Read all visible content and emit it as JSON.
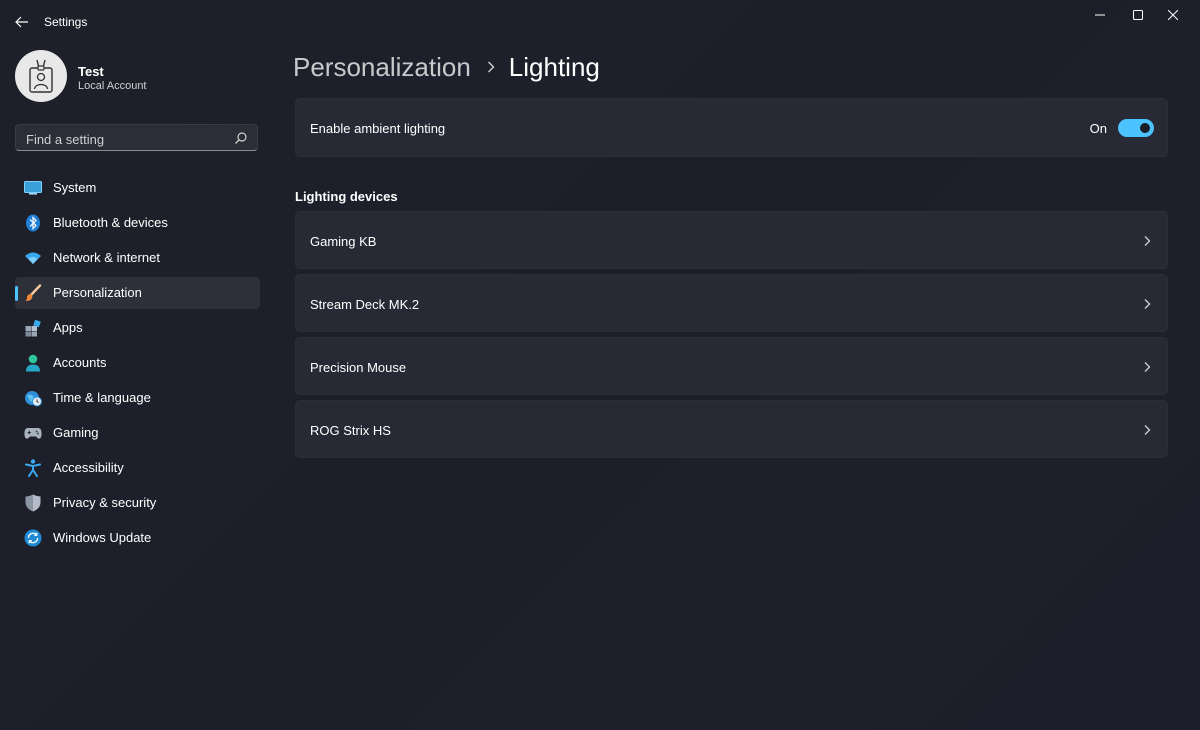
{
  "window": {
    "title": "Settings"
  },
  "user": {
    "name": "Test",
    "account_type": "Local Account"
  },
  "search": {
    "placeholder": "Find a setting",
    "value": ""
  },
  "nav": {
    "items": [
      {
        "label": "System",
        "icon": "monitor-icon"
      },
      {
        "label": "Bluetooth & devices",
        "icon": "bluetooth-icon"
      },
      {
        "label": "Network & internet",
        "icon": "wifi-icon"
      },
      {
        "label": "Personalization",
        "icon": "paintbrush-icon",
        "selected": true
      },
      {
        "label": "Apps",
        "icon": "apps-icon"
      },
      {
        "label": "Accounts",
        "icon": "person-icon"
      },
      {
        "label": "Time & language",
        "icon": "clock-globe-icon"
      },
      {
        "label": "Gaming",
        "icon": "gamepad-icon"
      },
      {
        "label": "Accessibility",
        "icon": "accessibility-icon"
      },
      {
        "label": "Privacy & security",
        "icon": "shield-icon"
      },
      {
        "label": "Windows Update",
        "icon": "update-icon"
      }
    ]
  },
  "breadcrumb": {
    "parent": "Personalization",
    "current": "Lighting"
  },
  "ambient": {
    "label": "Enable ambient lighting",
    "state_label": "On",
    "enabled": true
  },
  "devices": {
    "title": "Lighting devices",
    "items": [
      {
        "label": "Gaming KB"
      },
      {
        "label": "Stream Deck MK.2"
      },
      {
        "label": "Precision Mouse"
      },
      {
        "label": "ROG Strix HS"
      }
    ]
  },
  "colors": {
    "accent": "#4cc2ff",
    "background": "#1c1f2a",
    "card": "#272a35"
  }
}
